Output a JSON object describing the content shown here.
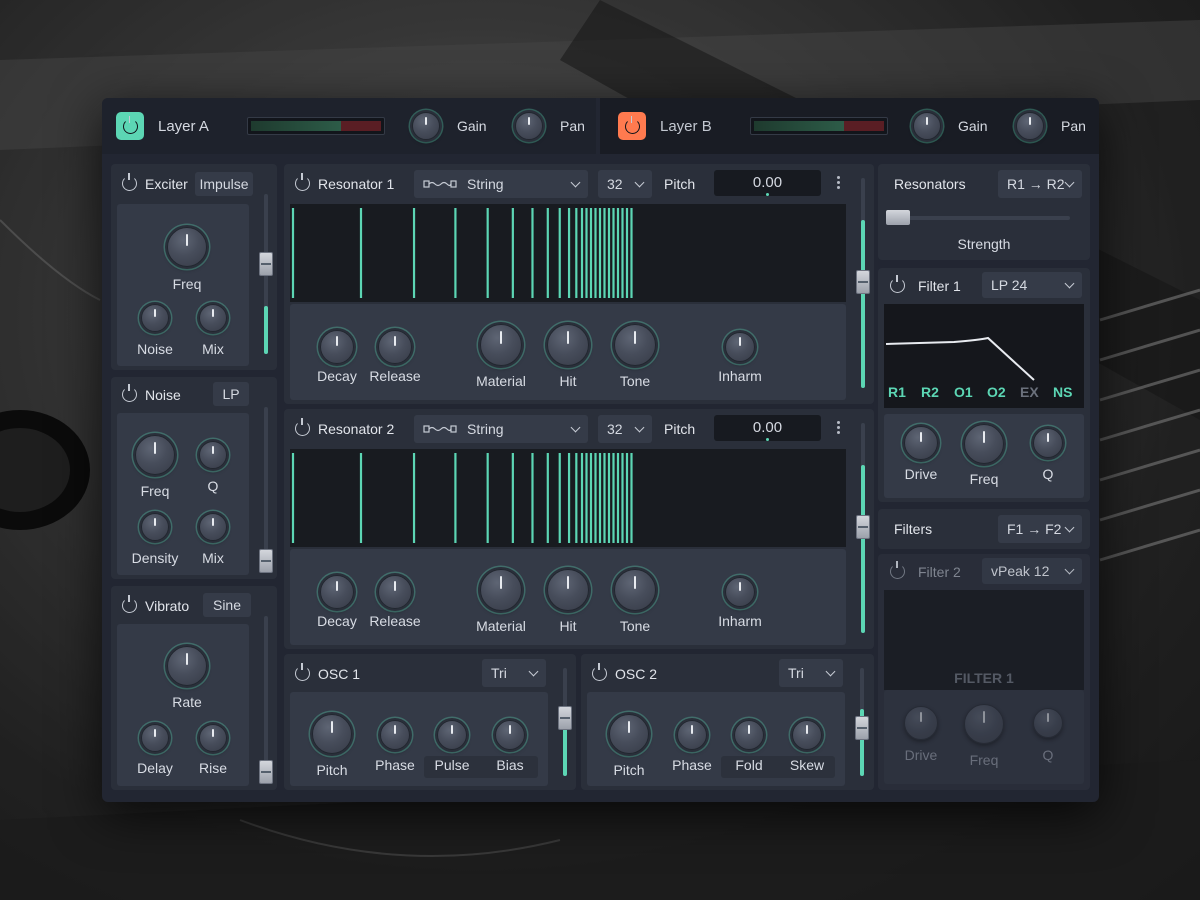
{
  "layers": {
    "a": {
      "name": "Layer A",
      "power_icon": "power-icon",
      "gain_label": "Gain",
      "pan_label": "Pan",
      "gain": 0.33,
      "pan": 0.5,
      "meter_level": 0.69,
      "power_color": "#5cd6b4"
    },
    "b": {
      "name": "Layer B",
      "power_icon": "power-icon",
      "gain_label": "Gain",
      "pan_label": "Pan",
      "gain": 0.33,
      "pan": 0.5,
      "meter_level": 0.69,
      "power_color": "#ff7a4f"
    }
  },
  "exciter": {
    "title": "Exciter",
    "mode": "Impulse",
    "freq_label": "Freq",
    "noise_label": "Noise",
    "mix_label": "Mix",
    "level": 0.3
  },
  "noise": {
    "title": "Noise",
    "mode": "LP",
    "freq_label": "Freq",
    "q_label": "Q",
    "density_label": "Density",
    "mix_label": "Mix",
    "level": 0.05
  },
  "vibrato": {
    "title": "Vibrato",
    "mode": "Sine",
    "rate_label": "Rate",
    "delay_label": "Delay",
    "rise_label": "Rise",
    "level": 0.0
  },
  "resonator1": {
    "title": "Resonator 1",
    "type": "String",
    "type_icon": "string-shape-icon",
    "voices": "32",
    "pitch_label": "Pitch",
    "pitch_value": "0.00",
    "labels": {
      "decay": "Decay",
      "release": "Release",
      "material": "Material",
      "hit": "Hit",
      "tone": "Tone",
      "inharm": "Inharm"
    },
    "level": 0.8
  },
  "resonator2": {
    "title": "Resonator 2",
    "type": "String",
    "type_icon": "string-shape-icon",
    "voices": "32",
    "pitch_label": "Pitch",
    "pitch_value": "0.00",
    "labels": {
      "decay": "Decay",
      "release": "Release",
      "material": "Material",
      "hit": "Hit",
      "tone": "Tone",
      "inharm": "Inharm"
    },
    "level": 0.8
  },
  "osc1": {
    "title": "OSC 1",
    "wave": "Tri",
    "pitch_label": "Pitch",
    "phase_label": "Phase",
    "pulse_label": "Pulse",
    "bias_label": "Bias",
    "level": 0.62
  },
  "osc2": {
    "title": "OSC 2",
    "wave": "Tri",
    "pitch_label": "Pitch",
    "phase_label": "Phase",
    "fold_label": "Fold",
    "skew_label": "Skew",
    "level": 0.62
  },
  "routing": {
    "title": "Resonators",
    "mode": "R1 → R2",
    "strength_label": "Strength",
    "strength": 0.05
  },
  "filter1": {
    "title": "Filter 1",
    "type": "LP 24",
    "sources": [
      "R1",
      "R2",
      "O1",
      "O2",
      "EX",
      "NS"
    ],
    "drive_label": "Drive",
    "freq_label": "Freq",
    "q_label": "Q"
  },
  "filters": {
    "title": "Filters",
    "mode": "F1 → F2"
  },
  "filter2": {
    "title": "Filter 2",
    "type": "vPeak 12",
    "placeholder": "FILTER 1",
    "drive_label": "Drive",
    "freq_label": "Freq",
    "q_label": "Q"
  },
  "colors": {
    "accent": "#5cd6b4",
    "layer_b": "#ff7a4f",
    "panel": "#2a2f3a"
  }
}
